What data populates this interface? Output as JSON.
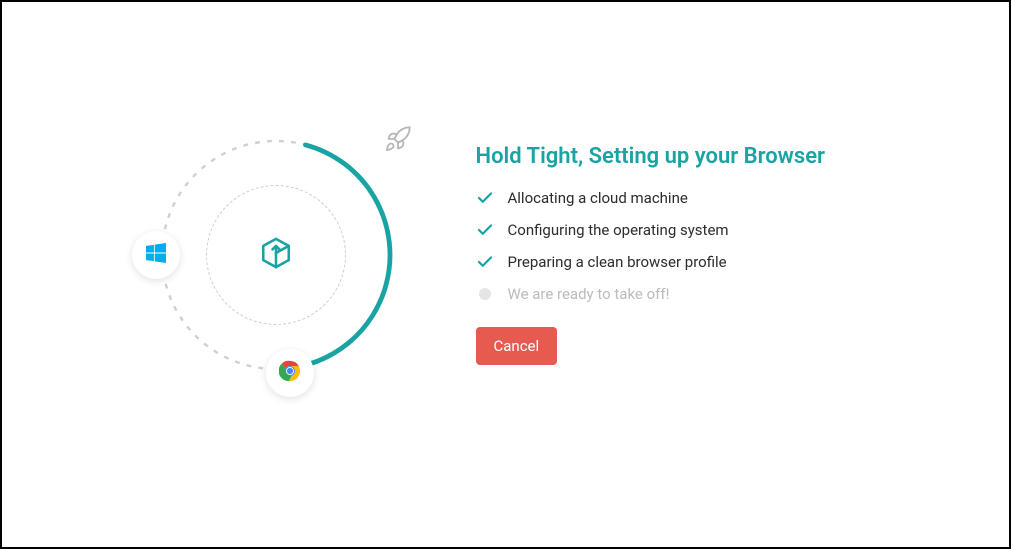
{
  "heading": "Hold Tight, Setting up your Browser",
  "steps": [
    {
      "label": "Allocating a cloud machine",
      "status": "done"
    },
    {
      "label": "Configuring the operating system",
      "status": "done"
    },
    {
      "label": "Preparing a clean browser profile",
      "status": "done"
    },
    {
      "label": "We are ready to take off!",
      "status": "pending"
    }
  ],
  "cancel_label": "Cancel",
  "colors": {
    "accent": "#1aa3a3",
    "danger": "#e65a50"
  }
}
